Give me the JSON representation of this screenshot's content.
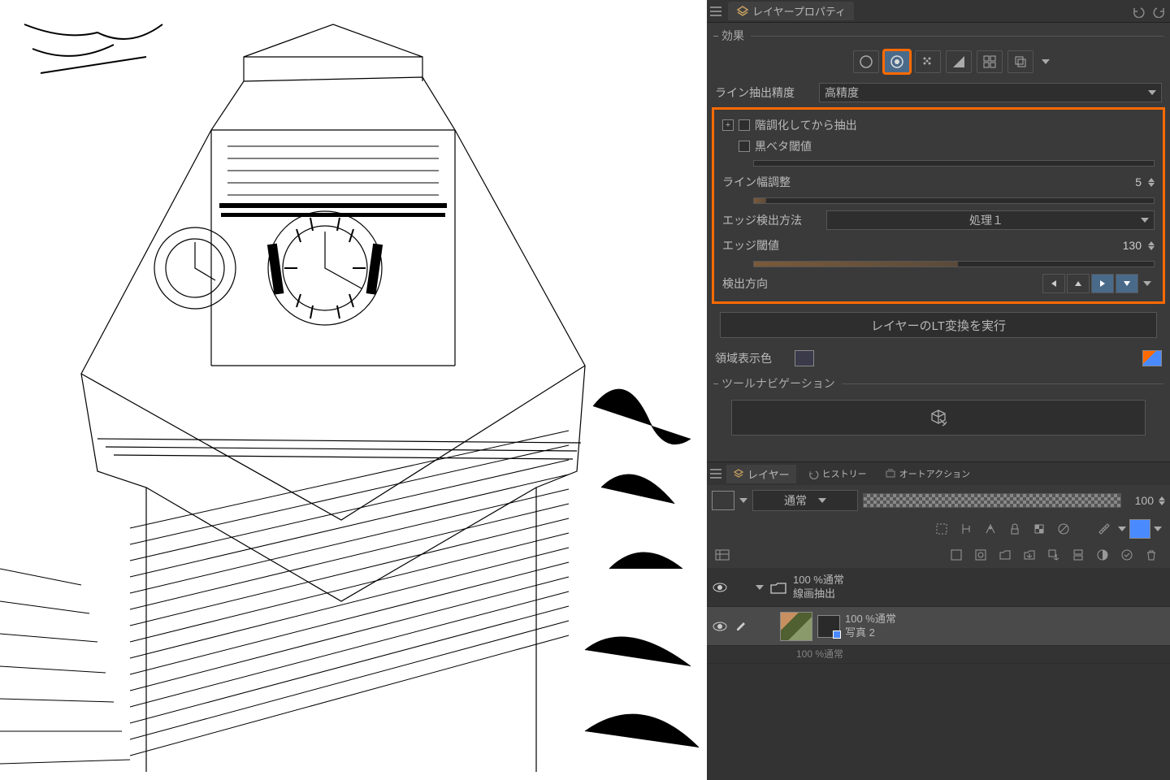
{
  "panel": {
    "title": "レイヤープロパティ",
    "section_effect": "効果",
    "line_precision_label": "ライン抽出精度",
    "line_precision_value": "高精度",
    "posterize_label": "階調化してから抽出",
    "black_threshold_label": "黒ベタ閾値",
    "line_width_label": "ライン幅調整",
    "line_width_value": "5",
    "edge_method_label": "エッジ検出方法",
    "edge_method_value": "処理１",
    "edge_threshold_label": "エッジ閾値",
    "edge_threshold_value": "130",
    "detect_direction_label": "検出方向",
    "exec_button": "レイヤーのLT変換を実行",
    "region_color_label": "領域表示色",
    "tool_nav_label": "ツールナビゲーション"
  },
  "layers": {
    "tab_layer": "レイヤー",
    "tab_history": "ヒストリー",
    "tab_auto": "オートアクション",
    "blend_mode": "通常",
    "opacity_value": "100",
    "group": {
      "opacity": "100 %通常",
      "name": "線画抽出"
    },
    "item1": {
      "opacity": "100 %通常",
      "name": "写真 2"
    },
    "item2": {
      "opacity": "100 %通常"
    }
  }
}
